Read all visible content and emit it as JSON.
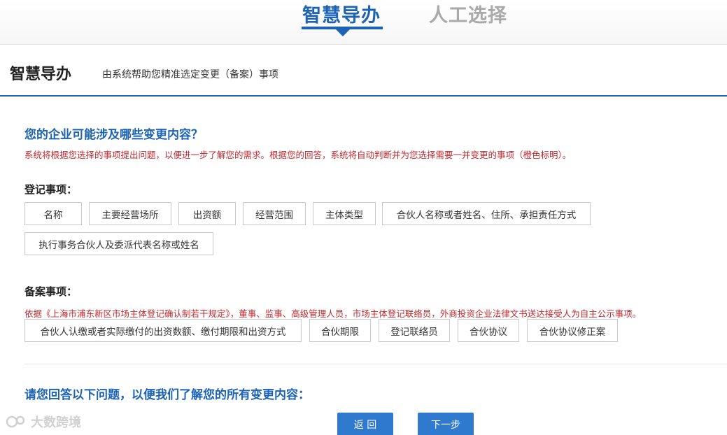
{
  "top_tabs": {
    "active_label": "智慧导办",
    "inactive_label": "人工选择"
  },
  "header": {
    "title": "智慧导办",
    "subtitle": "由系统帮助您精准选定变更（备案）事项"
  },
  "question_section": {
    "title": "您的企业可能涉及哪些变更内容？",
    "notice": "系统将根据您选择的事项提出问题，以便进一步了解您的需求。根据您的回答，系统将自动判断并为您选择需要一并变更的事项（橙色标明）。"
  },
  "registration": {
    "label": "登记事项：",
    "items": [
      "名称",
      "主要经营场所",
      "出资额",
      "经营范围",
      "主体类型",
      "合伙人名称或者姓名、住所、承担责任方式",
      "执行事务合伙人及委派代表名称或姓名"
    ]
  },
  "filing": {
    "label": "备案事项：",
    "notice": "依据《上海市浦东新区市场主体登记确认制若干规定》，董事、监事、高级管理人员，市场主体登记联络员，外商投资企业法律文书送达接受人为自主公示事项。",
    "items": [
      "合伙人认缴或者实际缴付的出资数额、缴付期限和出资方式",
      "合伙期限",
      "登记联络员",
      "合伙协议",
      "合伙协议修正案"
    ]
  },
  "answer_section": {
    "title": "请您回答以下问题，以便我们了解您的所有变更内容："
  },
  "buttons": {
    "back": "返 回",
    "next": "下一步"
  },
  "watermark": {
    "text": "大数跨境"
  },
  "colors": {
    "accent": "#1d63b4",
    "button": "#2f79cf",
    "notice": "#c0282d"
  }
}
